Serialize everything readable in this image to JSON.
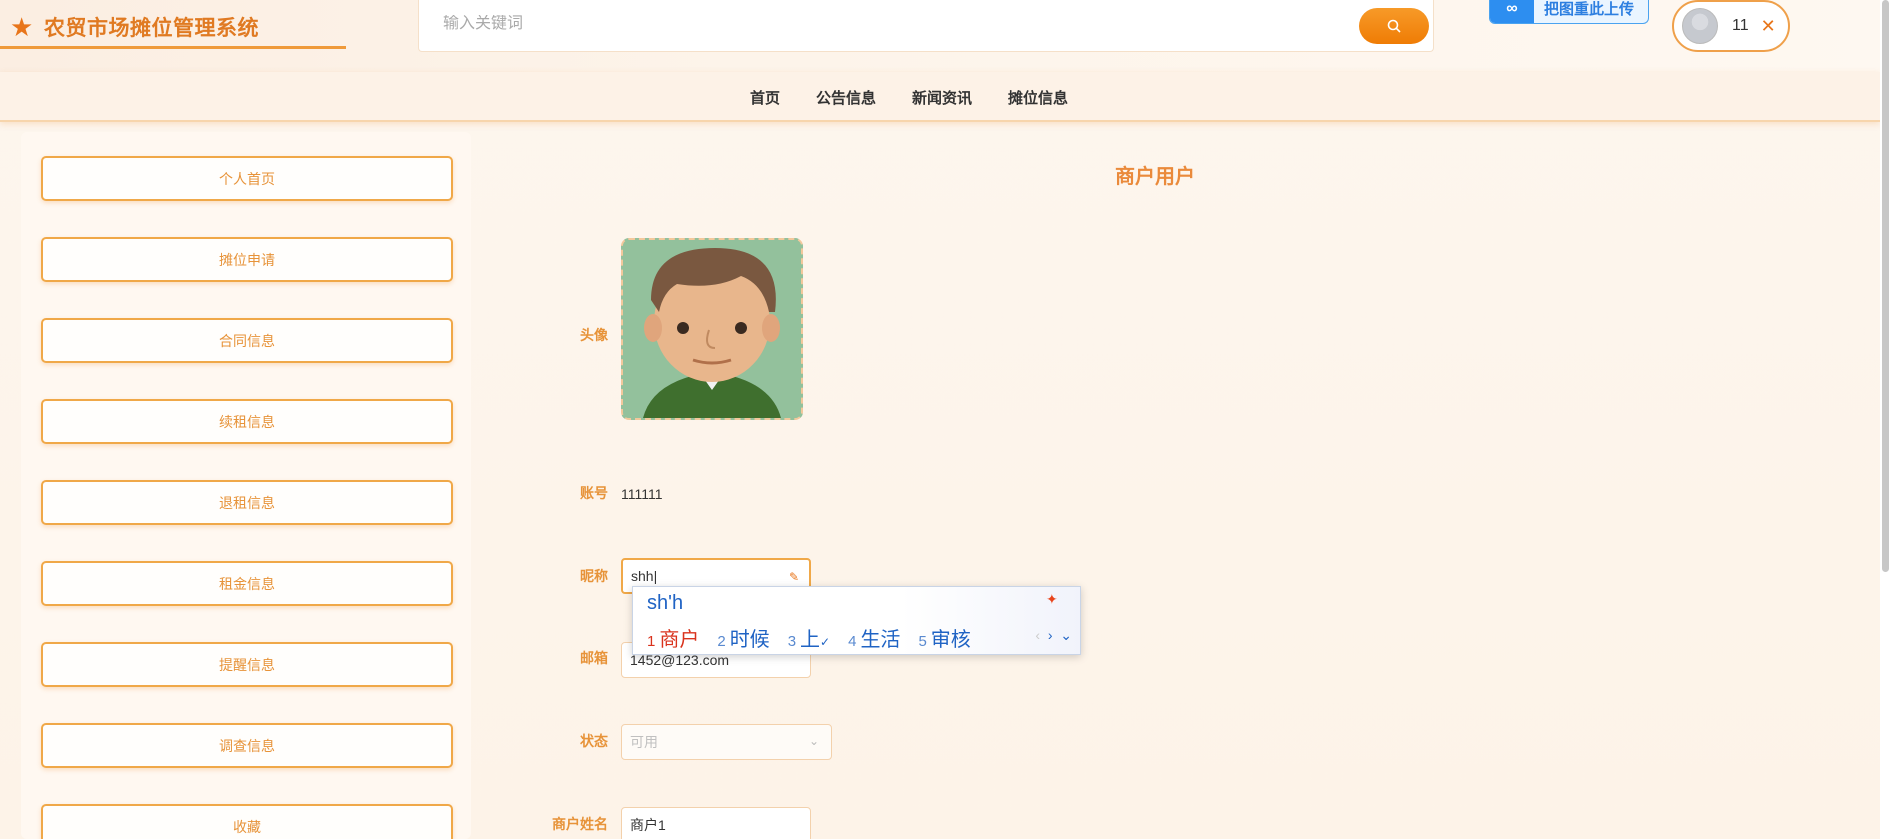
{
  "app": {
    "title": "农贸市场摊位管理系统",
    "brand_color": "#e07a22"
  },
  "search": {
    "placeholder": "输入关键词",
    "value": ""
  },
  "upload_badge": {
    "text": "把图重此上传"
  },
  "user": {
    "name": "11"
  },
  "nav": {
    "items": [
      "首页",
      "公告信息",
      "新闻资讯",
      "摊位信息"
    ]
  },
  "sidebar": {
    "items": [
      {
        "label": "个人首页"
      },
      {
        "label": "摊位申请"
      },
      {
        "label": "合同信息"
      },
      {
        "label": "续租信息"
      },
      {
        "label": "退租信息"
      },
      {
        "label": "租金信息"
      },
      {
        "label": "提醒信息"
      },
      {
        "label": "调查信息"
      },
      {
        "label": "收藏"
      }
    ]
  },
  "main": {
    "title": "商户用户",
    "fields": {
      "avatar_label": "头像",
      "account_label": "账号",
      "account_value": "111111",
      "nickname_label": "昵称",
      "nickname_value": "shh",
      "email_label": "邮箱",
      "email_value": "1452@123.com",
      "status_label": "状态",
      "status_value": "可用",
      "merchant_name_label": "商户姓名",
      "merchant_name_value": "商户1"
    }
  },
  "ime": {
    "typed": "sh'h",
    "candidates": [
      {
        "n": "1",
        "text": "商户"
      },
      {
        "n": "2",
        "text": "时候"
      },
      {
        "n": "3",
        "text": "上"
      },
      {
        "n": "4",
        "text": "生活"
      },
      {
        "n": "5",
        "text": "审核"
      }
    ]
  }
}
